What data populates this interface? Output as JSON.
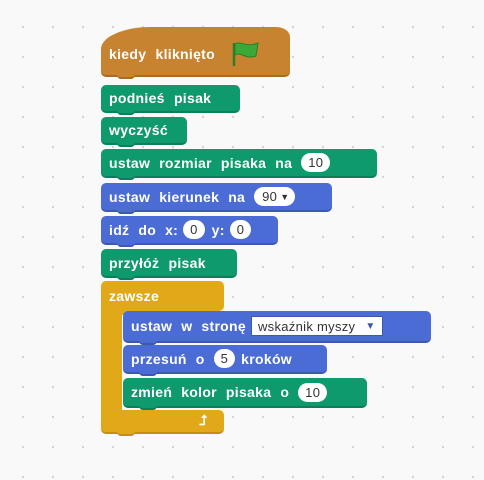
{
  "script": {
    "hat": {
      "label": "kiedy kliknięto",
      "icon": "green-flag-icon"
    },
    "pen_up": "podnieś pisak",
    "clear": "wyczyść",
    "set_pen_size": {
      "label_1": "ustaw",
      "label_2": "rozmiar",
      "label_3": "pisaka",
      "label_4": "na",
      "value": "10"
    },
    "point_direction": {
      "label_1": "ustaw",
      "label_2": "kierunek",
      "label_3": "na",
      "value": "90"
    },
    "goto_xy": {
      "label_1": "idź",
      "label_2": "do",
      "label_3": "x:",
      "x": "0",
      "label_4": "y:",
      "y": "0"
    },
    "pen_down": "przyłóż pisak",
    "forever": {
      "label": "zawsze",
      "point_towards": {
        "label_1": "ustaw",
        "label_2": "w",
        "label_3": "stronę",
        "target": "wskaźnik myszy"
      },
      "move": {
        "label_1": "przesuń",
        "label_2": "o",
        "value": "5",
        "label_3": "kroków"
      },
      "change_color": {
        "label_1": "zmień",
        "label_2": "kolor",
        "label_3": "pisaka",
        "label_4": "o",
        "value": "10"
      }
    }
  },
  "colors": {
    "pen": "#0e9a6c",
    "motion": "#4a6cd4",
    "control": "#e1a91a",
    "events": "#c88330",
    "flag": "#3aa935"
  }
}
